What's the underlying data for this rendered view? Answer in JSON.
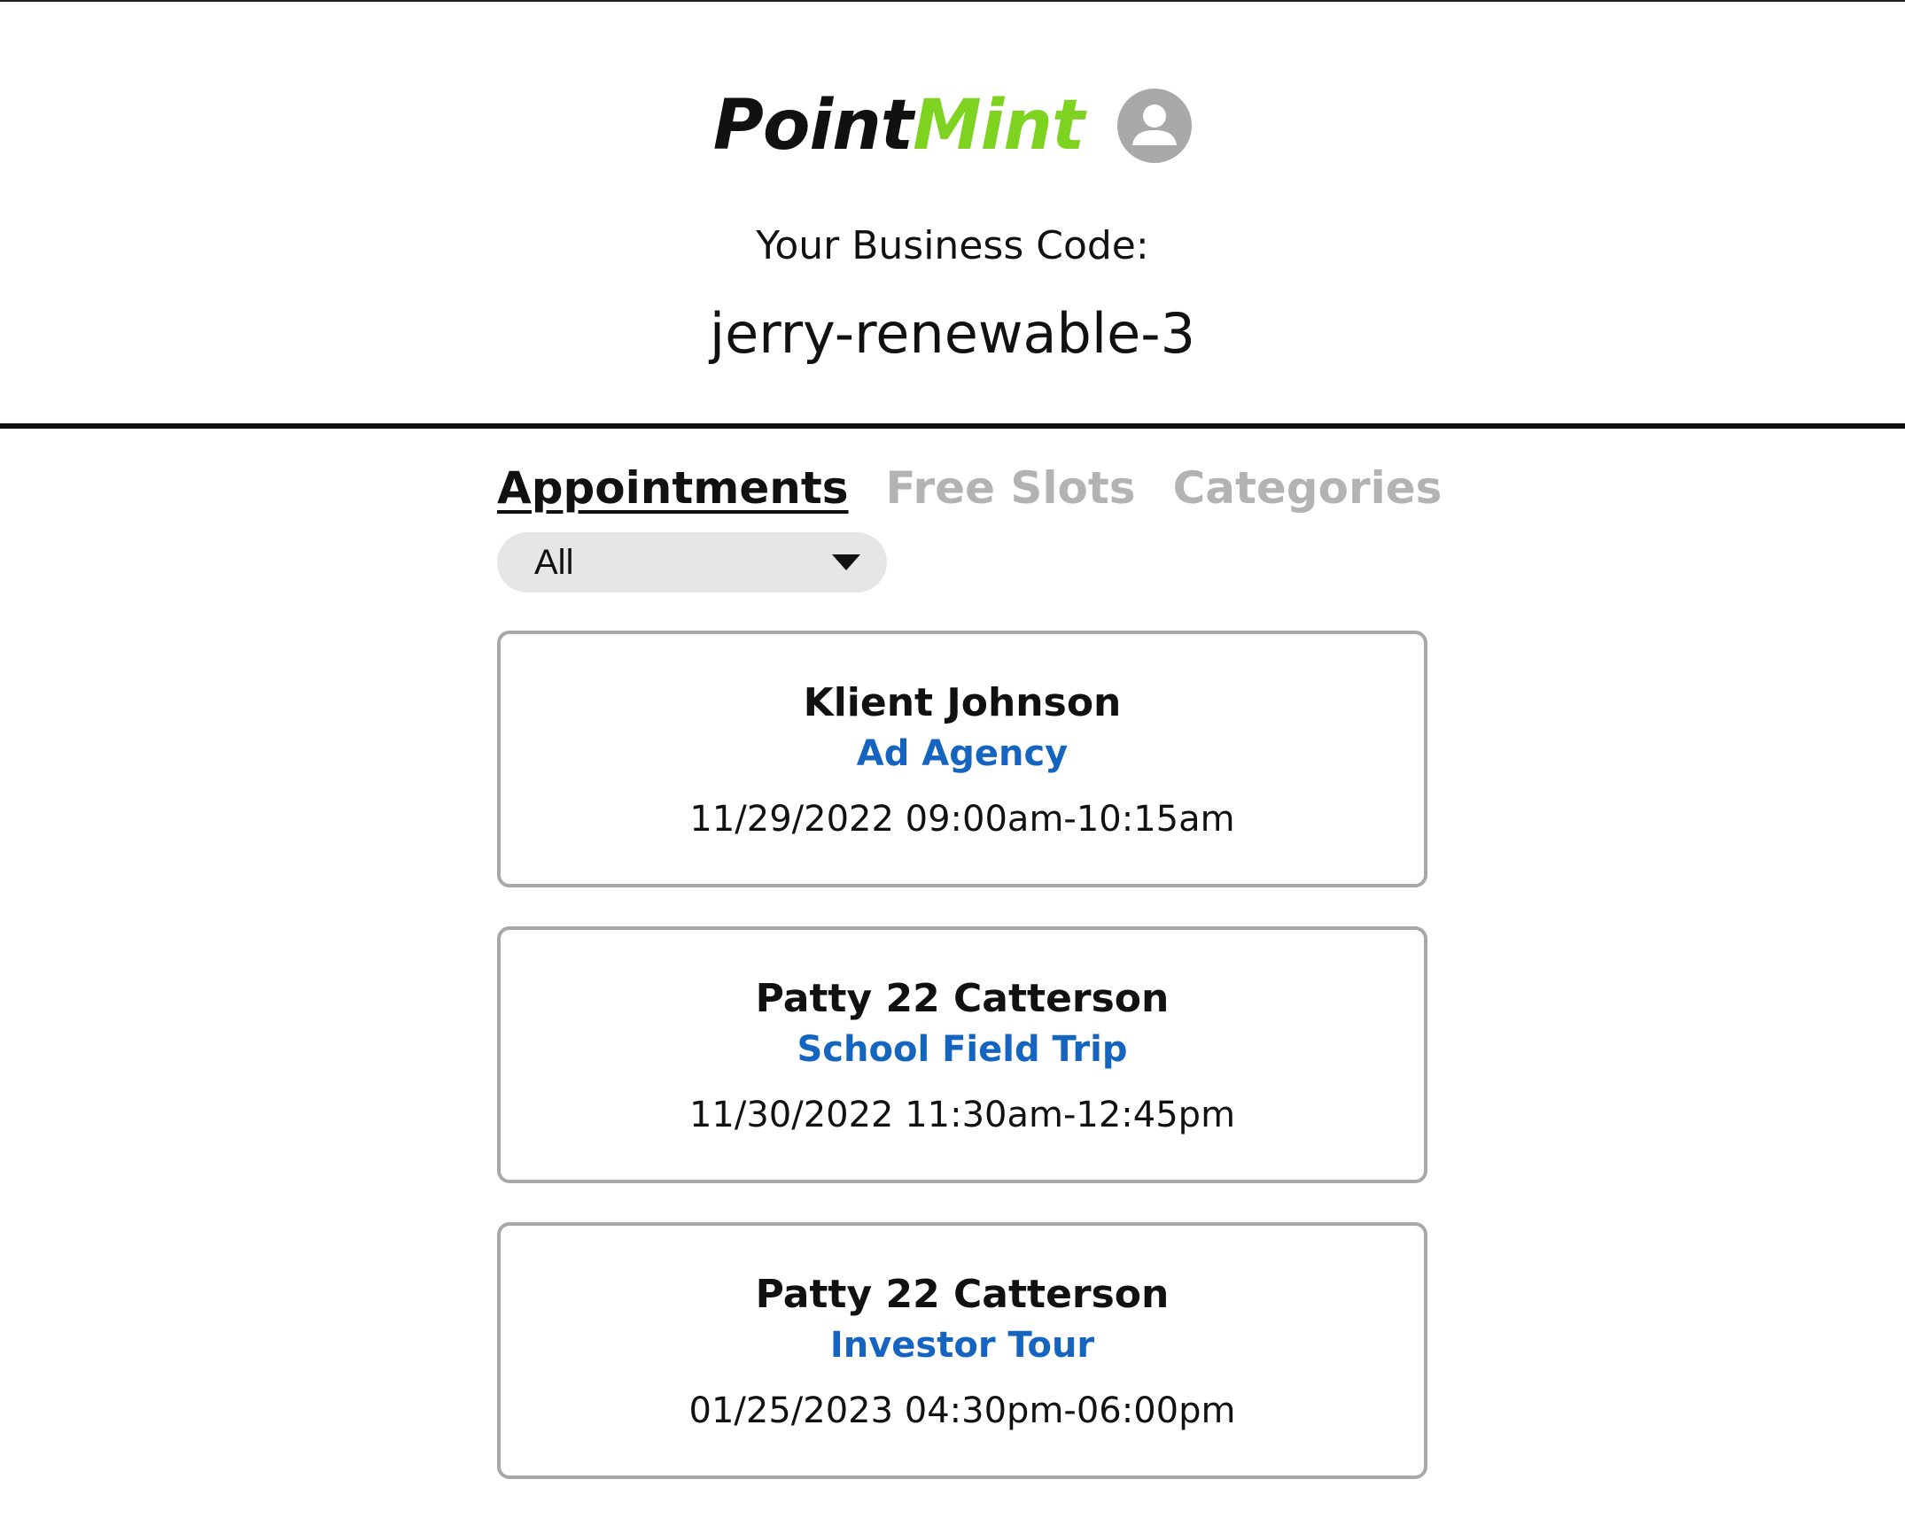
{
  "brand": {
    "logo_part1": "Point",
    "logo_part2": "Mint",
    "logo_part2_color": "#7ed321",
    "avatar_icon": "user-circle-icon"
  },
  "business": {
    "code_label": "Your Business Code:",
    "code_value": "jerry-renewable-3"
  },
  "tabs": [
    {
      "label": "Appointments",
      "active": true
    },
    {
      "label": "Free Slots",
      "active": false
    },
    {
      "label": "Categories",
      "active": false
    }
  ],
  "filter": {
    "selected": "All",
    "icon": "caret-down-icon"
  },
  "appointments": [
    {
      "name": "Klient Johnson",
      "category": "Ad Agency",
      "time": "11/29/2022 09:00am-10:15am"
    },
    {
      "name": "Patty 22 Catterson",
      "category": "School Field Trip",
      "time": "11/30/2022 11:30am-12:45pm"
    },
    {
      "name": "Patty 22 Catterson",
      "category": "Investor Tour",
      "time": "01/25/2023 04:30pm-06:00pm"
    }
  ],
  "colors": {
    "category_text": "#1565c0",
    "inactive_tab": "#b3b3b3",
    "card_border": "#a8a8a8"
  }
}
